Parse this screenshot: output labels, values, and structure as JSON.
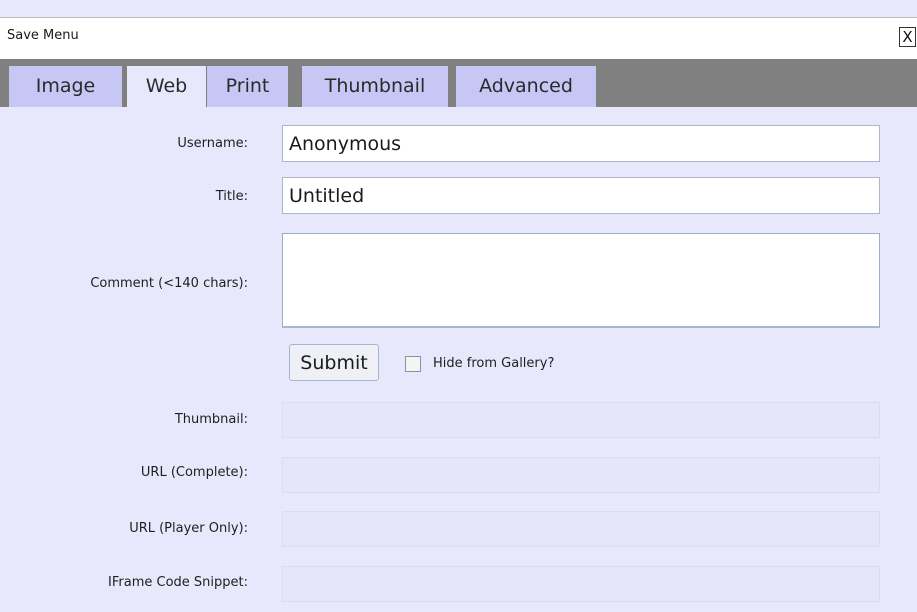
{
  "window": {
    "title": "Save Menu",
    "close_label": "X"
  },
  "tabs": [
    {
      "label": "Image",
      "active": false
    },
    {
      "label": "Web",
      "active": true
    },
    {
      "label": "Print",
      "active": false
    },
    {
      "label": "Thumbnail",
      "active": false
    },
    {
      "label": "Advanced",
      "active": false
    }
  ],
  "form": {
    "username_label": "Username:",
    "username_value": "Anonymous",
    "title_label": "Title:",
    "title_value": "Untitled",
    "comment_label": "Comment (<140 chars):",
    "comment_value": "",
    "submit_label": "Submit",
    "hide_label": "Hide from Gallery?",
    "hide_checked": false,
    "thumbnail_label": "Thumbnail:",
    "url_complete_label": "URL (Complete):",
    "url_player_label": "URL (Player Only):",
    "iframe_label": "IFrame Code Snippet:"
  },
  "colors": {
    "panel_background": "#e8e8fc",
    "tab_strip": "#808080",
    "tab_inactive": "#c7c7f5"
  }
}
